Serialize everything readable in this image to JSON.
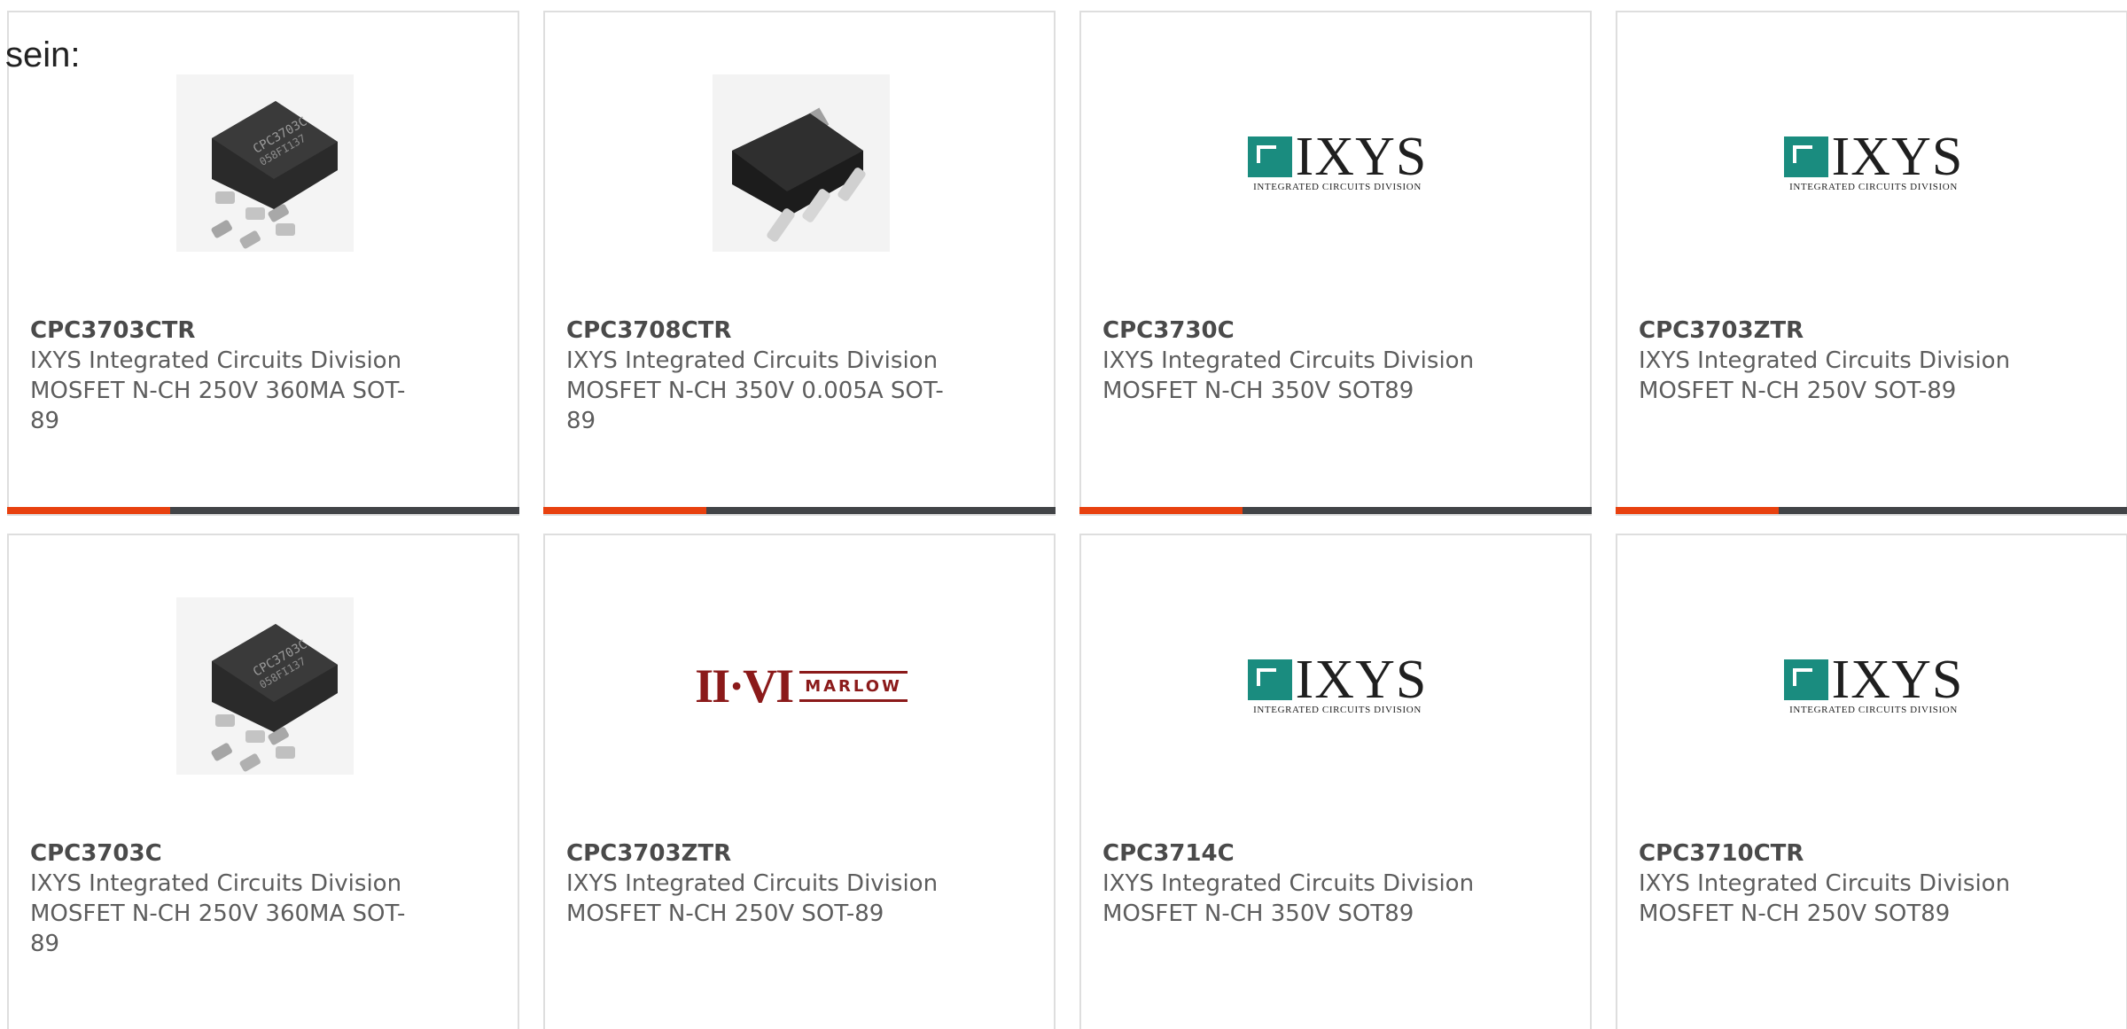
{
  "lead_text": "sein:",
  "colors": {
    "accent": "#e8410f",
    "bar": "#424447",
    "ixys_green": "#1a8c7f",
    "marlow_red": "#8b1a1a"
  },
  "logos": {
    "ixys": {
      "word": "IXYS",
      "sub": "Integrated Circuits Division"
    },
    "marlow": {
      "mark": "II·VI",
      "name": "MARLOW"
    }
  },
  "products": [
    {
      "part": "CPC3703CTR",
      "manufacturer": "IXYS Integrated Circuits Division",
      "description": "MOSFET N-CH 250V 360MA SOT-89",
      "image": "sot89-chip-photo-a",
      "chip_marking": "CPC3703C"
    },
    {
      "part": "CPC3708CTR",
      "manufacturer": "IXYS Integrated Circuits Division",
      "description": "MOSFET N-CH 350V 0.005A SOT-89",
      "image": "sot89-chip-photo-b"
    },
    {
      "part": "CPC3730C",
      "manufacturer": "IXYS Integrated Circuits Division",
      "description": "MOSFET N-CH 350V SOT89",
      "image": "ixys-logo"
    },
    {
      "part": "CPC3703ZTR",
      "manufacturer": "IXYS Integrated Circuits Division",
      "description": "MOSFET N-CH 250V SOT-89",
      "image": "ixys-logo"
    },
    {
      "part": "CPC3703C",
      "manufacturer": "IXYS Integrated Circuits Division",
      "description": "MOSFET N-CH 250V 360MA SOT-89",
      "image": "sot89-chip-photo-a",
      "chip_marking": "CPC3703C"
    },
    {
      "part": "CPC3703ZTR",
      "manufacturer": "IXYS Integrated Circuits Division",
      "description": "MOSFET N-CH 250V SOT-89",
      "image": "marlow-logo"
    },
    {
      "part": "CPC3714C",
      "manufacturer": "IXYS Integrated Circuits Division",
      "description": "MOSFET N-CH 350V SOT89",
      "image": "ixys-logo"
    },
    {
      "part": "CPC3710CTR",
      "manufacturer": "IXYS Integrated Circuits Division",
      "description": "MOSFET N-CH 250V SOT89",
      "image": "ixys-logo"
    }
  ]
}
